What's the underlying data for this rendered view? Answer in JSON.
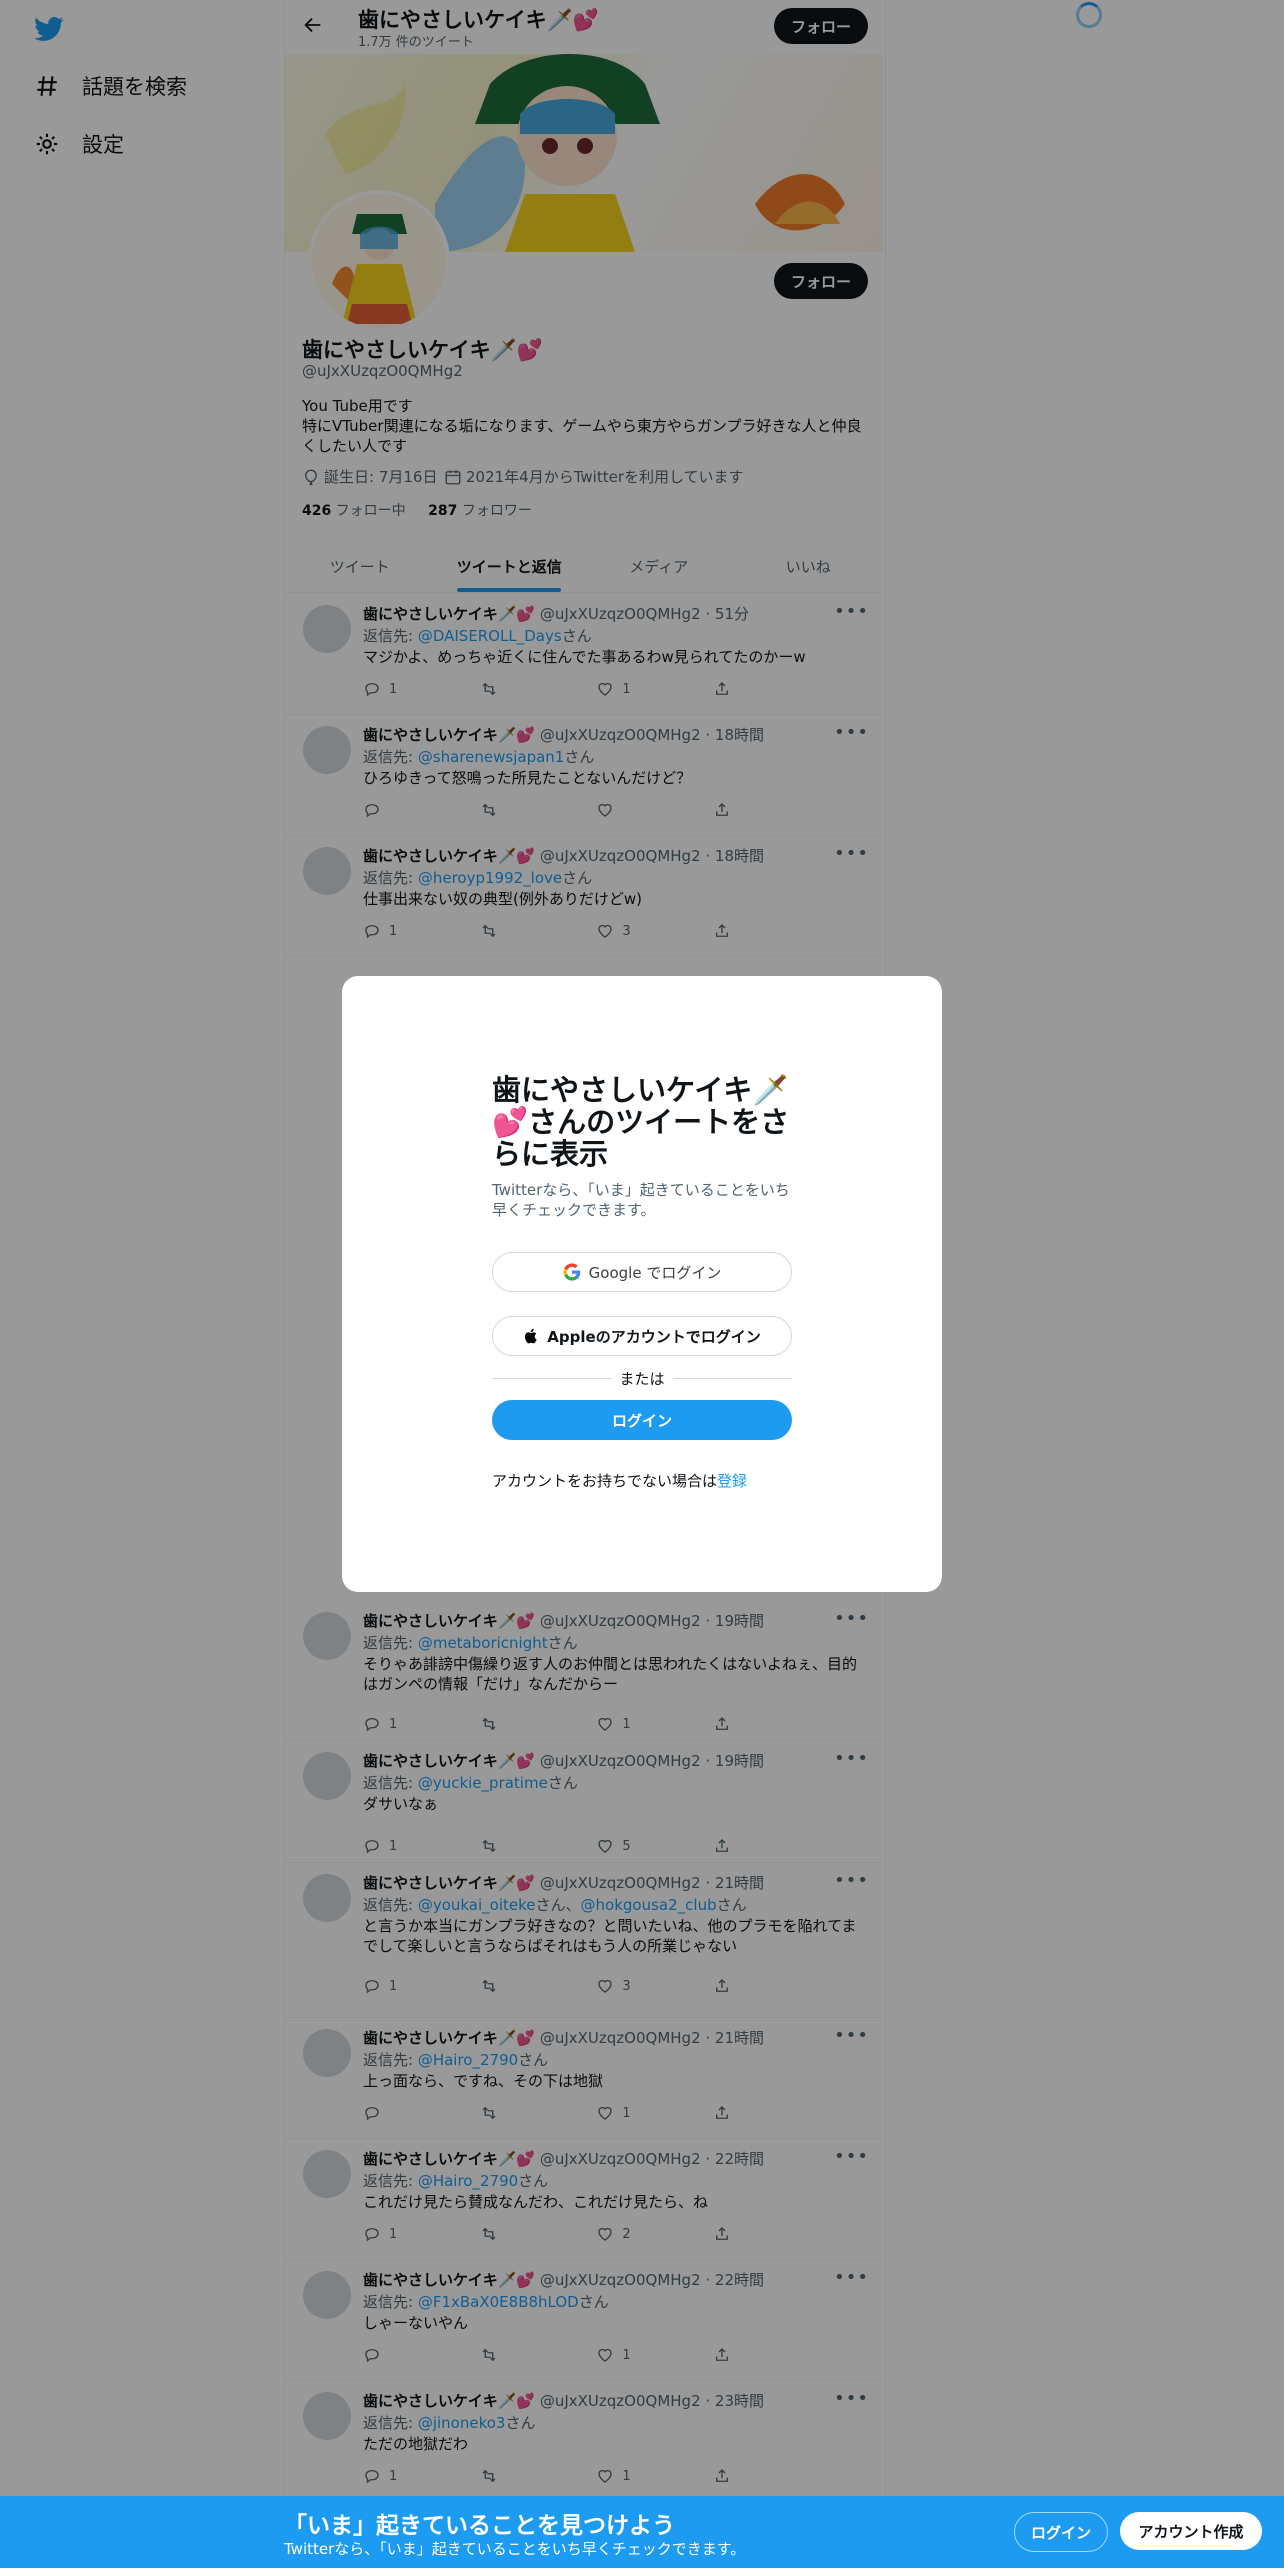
{
  "header": {
    "title": "歯にやさしいケイキ🗡️💕",
    "tweet_count": "1.7万 件のツイート",
    "follow_label": "フォロー"
  },
  "sidebar": {
    "explore_label": "話題を検索",
    "settings_label": "設定"
  },
  "profile": {
    "name": "歯にやさしいケイキ🗡️💕",
    "handle": "@uJxXUzqzO0QMHg2",
    "bio": "You Tube用です\n特にVTuber関連になる垢になります、ゲームやら東方やらガンプラ好きな人と仲良くしたい人です",
    "birthday": "誕生日: 7月16日",
    "joined": "2021年4月からTwitterを利用しています",
    "following_count": "426",
    "following_label": " フォロー中",
    "followers_count": "287",
    "followers_label": " フォロワー",
    "follow_label": "フォロー"
  },
  "tabs": [
    "ツイート",
    "ツイートと返信",
    "メディア",
    "いいね"
  ],
  "tweets": [
    {
      "name": "歯にやさしいケイキ🗡️💕",
      "handle": "@uJxXUzqzO0QMHg2 · 51分",
      "reply_prefix": "返信先: ",
      "reply_to": "@DAISEROLL_Days",
      "reply_suffix": "さん",
      "text": "マジかよ、めっちゃ近くに住んでた事あるわw見られてたのかーw",
      "reply_count": "1",
      "retweet_count": "",
      "like_count": "1"
    },
    {
      "name": "歯にやさしいケイキ🗡️💕",
      "handle": "@uJxXUzqzO0QMHg2 · 18時間",
      "reply_prefix": "返信先: ",
      "reply_to": "@sharenewsjapan1",
      "reply_suffix": "さん",
      "text": "ひろゆきって怒鳴った所見たことないんだけど？",
      "reply_count": "",
      "retweet_count": "",
      "like_count": ""
    },
    {
      "name": "歯にやさしいケイキ🗡️💕",
      "handle": "@uJxXUzqzO0QMHg2 · 18時間",
      "reply_prefix": "返信先: ",
      "reply_to": "@heroyp1992_love",
      "reply_suffix": "さん",
      "text": "仕事出来ない奴の典型(例外ありだけどw)",
      "reply_count": "1",
      "retweet_count": "",
      "like_count": "3"
    },
    {
      "name": "歯にやさしいケイキ🗡️💕",
      "handle": "@uJxXUzqzO0QMHg2 · 19時間",
      "reply_prefix": "返信先: ",
      "reply_to": "@metaboricnight",
      "reply_suffix": "さん",
      "text": "そりゃあ誹謗中傷繰り返す人のお仲間とは思われたくはないよねぇ、目的はガンペの情報「だけ」なんだからー",
      "reply_count": "1",
      "retweet_count": "",
      "like_count": "1"
    },
    {
      "name": "歯にやさしいケイキ🗡️💕",
      "handle": "@uJxXUzqzO0QMHg2 · 19時間",
      "reply_prefix": "返信先: ",
      "reply_to": "@yuckie_pratime",
      "reply_suffix": "さん",
      "text": "ダサいなぁ",
      "reply_count": "1",
      "retweet_count": "",
      "like_count": "5"
    },
    {
      "name": "歯にやさしいケイキ🗡️💕",
      "handle": "@uJxXUzqzO0QMHg2 · 21時間",
      "reply_prefix": "返信先: ",
      "reply_to": "@youkai_oiteke",
      "reply_mid": "さん、",
      "reply_to2": "@hokgousa2_club",
      "reply_suffix": "さん",
      "text": "と言うか本当にガンプラ好きなの？と問いたいね、他のプラモを陥れてまでして楽しいと言うならばそれはもう人の所業じゃない",
      "reply_count": "1",
      "retweet_count": "",
      "like_count": "3"
    },
    {
      "name": "歯にやさしいケイキ🗡️💕",
      "handle": "@uJxXUzqzO0QMHg2 · 21時間",
      "reply_prefix": "返信先: ",
      "reply_to": "@Hairo_2790",
      "reply_suffix": "さん",
      "text": "上っ面なら、ですね、その下は地獄",
      "reply_count": "",
      "retweet_count": "",
      "like_count": "1"
    },
    {
      "name": "歯にやさしいケイキ🗡️💕",
      "handle": "@uJxXUzqzO0QMHg2 · 22時間",
      "reply_prefix": "返信先: ",
      "reply_to": "@Hairo_2790",
      "reply_suffix": "さん",
      "text": "これだけ見たら賛成なんだわ、これだけ見たら、ね",
      "reply_count": "1",
      "retweet_count": "",
      "like_count": "2"
    },
    {
      "name": "歯にやさしいケイキ🗡️💕",
      "handle": "@uJxXUzqzO0QMHg2 · 22時間",
      "reply_prefix": "返信先: ",
      "reply_to": "@F1xBaX0E8B8hLOD",
      "reply_suffix": "さん",
      "text": "しゃーないやん",
      "reply_count": "",
      "retweet_count": "",
      "like_count": "1"
    },
    {
      "name": "歯にやさしいケイキ🗡️💕",
      "handle": "@uJxXUzqzO0QMHg2 · 23時間",
      "reply_prefix": "返信先: ",
      "reply_to": "@jinoneko3",
      "reply_suffix": "さん",
      "text": "ただの地獄だわ",
      "reply_count": "1",
      "retweet_count": "",
      "like_count": "1"
    }
  ],
  "modal": {
    "title": "歯にやさしいケイキ🗡️💕さんのツイートをさらに表示",
    "subtitle": "Twitterなら、「いま」起きていることをいち早くチェックできます。",
    "google_label": "Google でログイン",
    "apple_label": "Appleのアカウントでログイン",
    "or_label": "または",
    "login_label": "ログイン",
    "signup_prompt": "アカウントをお持ちでない場合は",
    "signup_link": "登録"
  },
  "bottom_bar": {
    "title": "「いま」起きていることを見つけよう",
    "subtitle": "Twitterなら、「いま」起きていることをいち早くチェックできます。",
    "login_label": "ログイン",
    "signup_label": "アカウント作成"
  },
  "colors": {
    "accent": "#1d9bf0",
    "text": "#0f1419",
    "secondary": "#536471"
  }
}
